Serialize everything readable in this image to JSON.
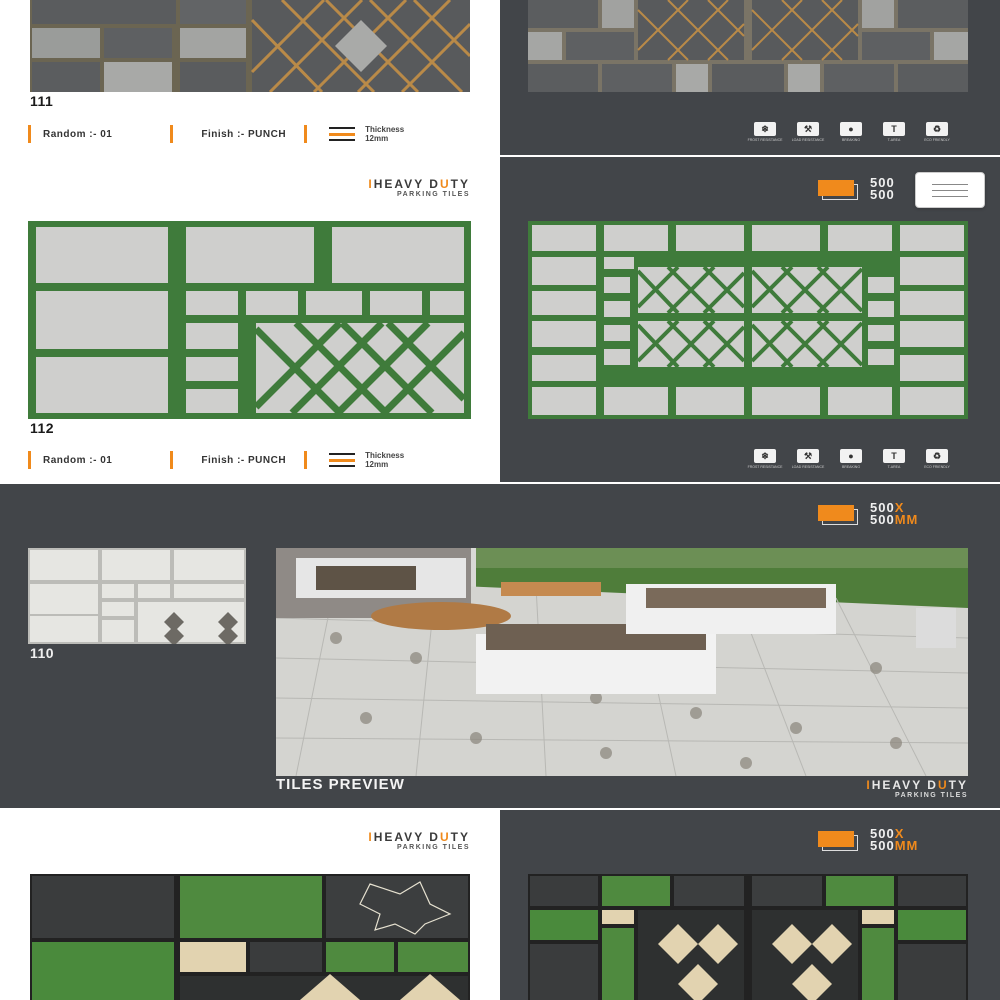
{
  "brand": {
    "line1_prefix": "H",
    "line1_rest": "EAVY D",
    "line1_accent": "U",
    "line1_end": "TY",
    "line2": "PARKING TILES"
  },
  "size_badge": {
    "line1_num": "500",
    "line1_unit": "X",
    "line2_num": "500",
    "line2_unit": "MM",
    "partial_line1": "500",
    "partial_line2": "500"
  },
  "sections": [
    {
      "code": "111",
      "random_label": "Random :- 01",
      "finish_label": "Finish :- PUNCH",
      "thickness_label": "Thickness",
      "thickness_value": "12mm"
    },
    {
      "code": "112",
      "random_label": "Random :- 01",
      "finish_label": "Finish :- PUNCH",
      "thickness_label": "Thickness",
      "thickness_value": "12mm"
    },
    {
      "code": "110",
      "preview_title": "TILES PREVIEW"
    }
  ],
  "features": [
    {
      "icon": "frost-resistance-icon",
      "glyph": "❄",
      "label": "FROST RESISTANCE"
    },
    {
      "icon": "load-resistance-icon",
      "glyph": "⚒",
      "label": "LOAD RESISTANCE"
    },
    {
      "icon": "breaking-icon",
      "glyph": "●",
      "label": "BREAKING"
    },
    {
      "icon": "t-area-icon",
      "glyph": "T",
      "label": "T-AREA"
    },
    {
      "icon": "eco-friendly-icon",
      "glyph": "♻",
      "label": "ECO FRIENDLY"
    }
  ],
  "colors": {
    "accent": "#f08a1c",
    "dark_panel": "#424549",
    "grass": "#3e7a3a",
    "stone_gray": "#5b5d5f"
  }
}
